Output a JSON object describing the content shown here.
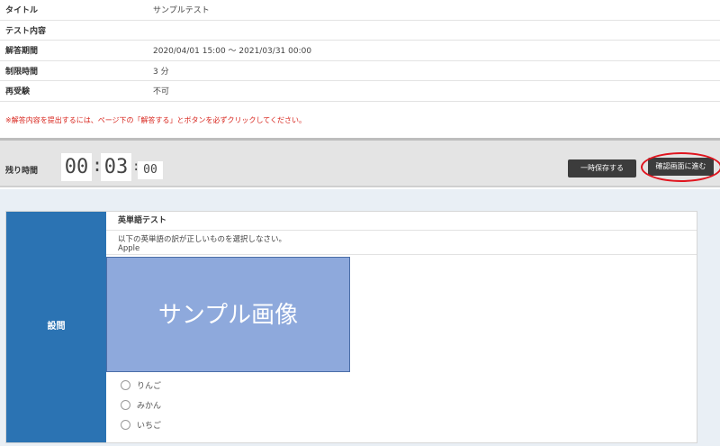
{
  "info": {
    "rows": [
      {
        "label": "タイトル",
        "value": "サンプルテスト"
      },
      {
        "label": "テスト内容",
        "value": ""
      },
      {
        "label": "解答期間",
        "value": "2020/04/01 15:00 ～ 2021/03/31 00:00"
      },
      {
        "label": "制限時間",
        "value": "3 分"
      },
      {
        "label": "再受験",
        "value": "不可"
      }
    ],
    "notice": "※解答内容を提出するには、ページ下の「解答する」とボタンを必ずクリックしてください。"
  },
  "timer": {
    "label": "残り時間",
    "hours": "00",
    "minutes": "03",
    "seconds": "00",
    "sep": ":"
  },
  "buttons": {
    "save": "一時保存する",
    "confirm": "確認画面に進む"
  },
  "question": {
    "side_label": "設問",
    "title": "英単語テスト",
    "instruction": "以下の英単語の訳が正しいものを選択しなさい。",
    "word": "Apple",
    "image_text": "サンプル画像",
    "options": [
      "りんご",
      "みかん",
      "いちご"
    ]
  },
  "colors": {
    "accent_blue": "#2b73b3",
    "notice_red": "#d8261e",
    "highlight_red": "#e0141e",
    "button_dark": "#3c3c3c",
    "image_fill": "#8ea9dc"
  }
}
